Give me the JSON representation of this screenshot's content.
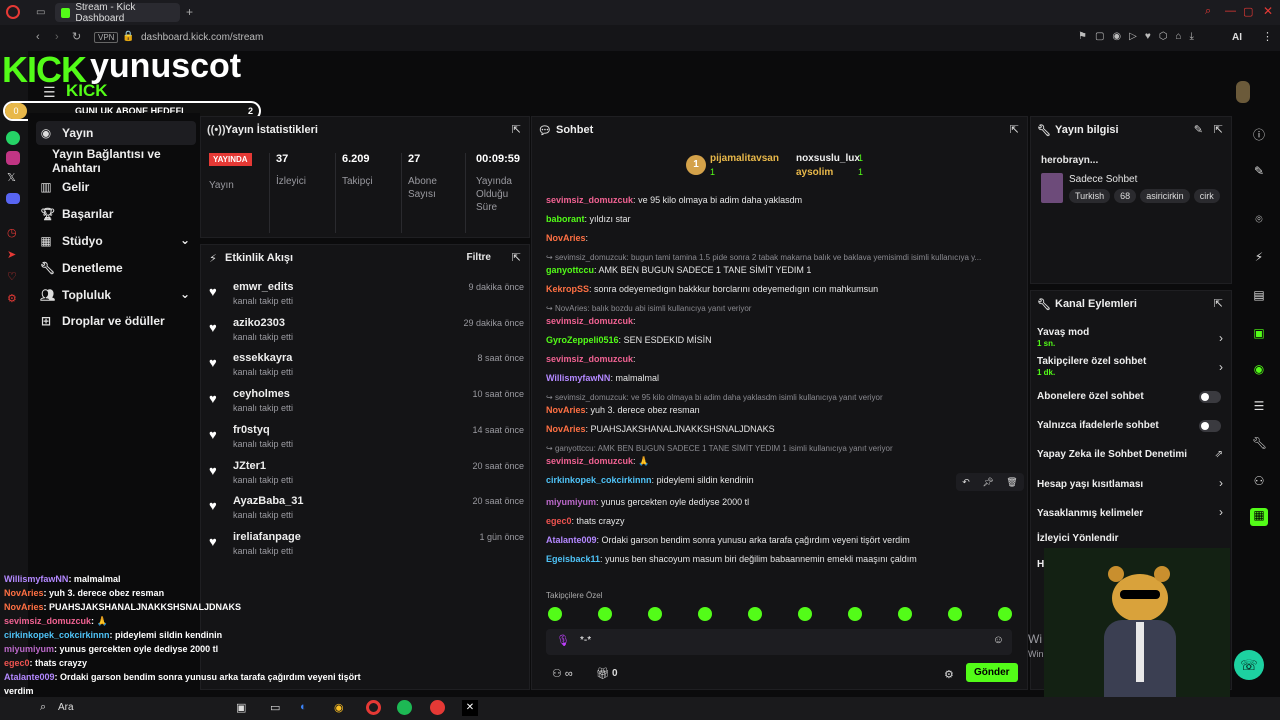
{
  "browser": {
    "tab_title": "Stream - Kick Dashboard",
    "new_tab": "+",
    "vpn": "VPN",
    "url": "dashboard.kick.com/stream",
    "ai_label": "AI"
  },
  "header": {
    "logo": "KICK",
    "channel": "yunuscot",
    "logo_small": "KICK",
    "goal_label": "GUNLUK ABONE HEDEFI",
    "goal_left": "0",
    "goal_right": "2"
  },
  "nav": {
    "items": [
      {
        "label": "Yayın"
      },
      {
        "label": "Yayın Bağlantısı ve Anahtarı"
      },
      {
        "label": "Gelir"
      },
      {
        "label": "Başarılar"
      },
      {
        "label": "Stüdyo"
      },
      {
        "label": "Denetleme"
      },
      {
        "label": "Topluluk"
      },
      {
        "label": "Droplar ve ödüller"
      }
    ]
  },
  "stats": {
    "title": "Yayın İstatistikleri",
    "live_badge": "YAYINDA",
    "live_label": "Yayın",
    "viewers": "37",
    "viewers_label": "İzleyici",
    "followers": "6.209",
    "followers_label": "Takipçi",
    "subs": "27",
    "subs_label": "Abone Sayısı",
    "uptime": "00:09:59",
    "uptime_label": "Yayında Olduğu Süre"
  },
  "activity": {
    "title": "Etkinlik Akışı",
    "filter": "Filtre",
    "items": [
      {
        "name": "emwr_edits",
        "action": "kanalı takip etti",
        "time": "9 dakika önce"
      },
      {
        "name": "aziko2303",
        "action": "kanalı takip etti",
        "time": "29 dakika önce"
      },
      {
        "name": "essekkayra",
        "action": "kanalı takip etti",
        "time": "8 saat önce"
      },
      {
        "name": "ceyholmes",
        "action": "kanalı takip etti",
        "time": "10 saat önce"
      },
      {
        "name": "fr0styq",
        "action": "kanalı takip etti",
        "time": "14 saat önce"
      },
      {
        "name": "JZter1",
        "action": "kanalı takip etti",
        "time": "20 saat önce"
      },
      {
        "name": "AyazBaba_31",
        "action": "kanalı takip etti",
        "time": "20 saat önce"
      },
      {
        "name": "ireliafanpage",
        "action": "kanalı takip etti",
        "time": "1 gün önce"
      }
    ]
  },
  "chat": {
    "title": "Sohbet",
    "top1_name": "pijamalitavsan",
    "top1_count": "1",
    "top2_name": "noxsuslu_lux",
    "top2_count": "1",
    "top3_name": "aysolim",
    "top3_count": "1",
    "messages": [
      {
        "kind": "msg",
        "user": "sevimsiz_domuzcuk",
        "color": "#f06292",
        "text": "ve 95 kilo olmaya bi adim daha yaklasdm"
      },
      {
        "kind": "msg",
        "user": "baborant",
        "color": "#53fc18",
        "text": "yıldızı star"
      },
      {
        "kind": "msg",
        "user": "NovAries",
        "color": "#ff7043",
        "text": ""
      },
      {
        "kind": "reply",
        "text": "sevimsiz_domuzcuk: bugun tami tamina 1.5 pide sonra 2 tabak makarna balık ve baklava yemisimdi isimli kullanıcıya y..."
      },
      {
        "kind": "msg",
        "user": "ganyottccu",
        "color": "#53fc18",
        "text": "AMK BEN BUGUN SADECE 1 TANE SİMİT YEDIM 1"
      },
      {
        "kind": "msg",
        "user": "KekropSS",
        "color": "#ff7043",
        "text": "sonra odeyemedıgın bakkkur borclarını odeyemedıgın ıcın mahkumsun"
      },
      {
        "kind": "reply",
        "text": "NovAries: balık bozdu abi isimli kullanıcıya yanıt veriyor"
      },
      {
        "kind": "msg",
        "user": "sevimsiz_domuzcuk",
        "color": "#f06292",
        "text": ""
      },
      {
        "kind": "msg",
        "user": "GyroZeppeli0516",
        "color": "#53fc18",
        "text": "SEN ESDEKID MİSİN"
      },
      {
        "kind": "msg",
        "user": "sevimsiz_domuzcuk",
        "color": "#f06292",
        "text": ""
      },
      {
        "kind": "msg",
        "user": "WillismyfawNN",
        "color": "#b388ff",
        "text": "malmalmal"
      },
      {
        "kind": "reply",
        "text": "sevimsiz_domuzcuk: ve 95 kilo olmaya bi adim daha yaklasdm isimli kullanıcıya yanıt veriyor"
      },
      {
        "kind": "msg",
        "user": "NovAries",
        "color": "#ff7043",
        "text": "yuh 3. derece obez resman"
      },
      {
        "kind": "msg",
        "user": "NovAries",
        "color": "#ff7043",
        "text": "PUAHSJAKSHANALJNAKKSHSNALJDNAKS"
      },
      {
        "kind": "reply",
        "text": "ganyottccu: AMK BEN BUGUN SADECE 1 TANE SİMİT YEDIM 1 isimli kullanıcıya yanıt veriyor"
      },
      {
        "kind": "msg",
        "user": "sevimsiz_domuzcuk",
        "color": "#f06292",
        "text": "🙏"
      },
      {
        "kind": "msg",
        "user": "cirkinkopek_cokcirkinnn",
        "color": "#4fc3f7",
        "text": "pideylemi sildin kendinin"
      },
      {
        "kind": "msg",
        "user": "miyumiyum",
        "color": "#ba68c8",
        "text": "yunus gercekten oyle dediyse 2000 tl"
      },
      {
        "kind": "msg",
        "user": "egec0",
        "color": "#ef5350",
        "text": "thats crayzy"
      },
      {
        "kind": "msg",
        "user": "Atalante009",
        "color": "#b388ff",
        "text": "Ordaki garson bendim sonra yunusu arka tarafa çağırdım veyeni tişört verdim"
      },
      {
        "kind": "msg",
        "user": "Egeisback11",
        "color": "#4fc3f7",
        "text": "yunus ben shacoyum masum biri değilim babaannemin emekli maaşını çaldım"
      }
    ],
    "followers_only": "Takipçilere Özel",
    "input_value": "*-*",
    "points": "0",
    "send": "Gönder"
  },
  "stream_info": {
    "title": "Yayın bilgisi",
    "stream_title": "herobrayn...",
    "category": "Sadece Sohbet",
    "tags": [
      "Turkish",
      "68",
      "asiricirkin",
      "cirk"
    ]
  },
  "channel_actions": {
    "title": "Kanal Eylemleri",
    "slow_mode": "Yavaş mod",
    "slow_mode_val": "1 sn.",
    "followers_chat": "Takipçilere özel sohbet",
    "followers_chat_val": "1 dk.",
    "subs_chat": "Abonelere özel sohbet",
    "emote_chat": "Yalnızca ifadelerle sohbet",
    "ai_moderation": "Yapay Zeka ile Sohbet Denetimi",
    "age_limit": "Hesap yaşı kısıtlaması",
    "banned_words": "Yasaklanmış kelimeler",
    "redirect": "İzleyici Yönlendir",
    "partial": "H"
  },
  "overlay_chat": [
    {
      "user": "WillismyfawNN",
      "color": "#b388ff",
      "text": ": malmalmal"
    },
    {
      "user": "NovAries",
      "color": "#ff7043",
      "text": ": yuh 3. derece obez resman"
    },
    {
      "user": "NovAries",
      "color": "#ff7043",
      "text": ": PUAHSJAKSHANALJNAKKSHSNALJDNAKS"
    },
    {
      "user": "sevimsiz_domuzcuk",
      "color": "#f06292",
      "text": ": 🙏"
    },
    {
      "user": "cirkinkopek_cokcirkinnn",
      "color": "#4fc3f7",
      "text": ": pideylemi sildin kendinin"
    },
    {
      "user": "miyumiyum",
      "color": "#ba68c8",
      "text": ": yunus gercekten oyle dediyse 2000 tl"
    },
    {
      "user": "egec0",
      "color": "#ef5350",
      "text": ": thats crayzy"
    },
    {
      "user": "Atalante009",
      "color": "#b388ff",
      "text": ": Ordaki garson bendim sonra yunusu arka tarafa çağırdım veyeni tişört"
    },
    {
      "user": "",
      "color": "#ffffff",
      "text": "verdim"
    }
  ],
  "taskbar": {
    "search": "Ara",
    "win_partial1": "Wi",
    "win_partial2": "Win"
  },
  "colors": {
    "accent": "#53fc18",
    "live": "#e53935",
    "bg": "#0b0b0c",
    "panel": "#141416"
  }
}
